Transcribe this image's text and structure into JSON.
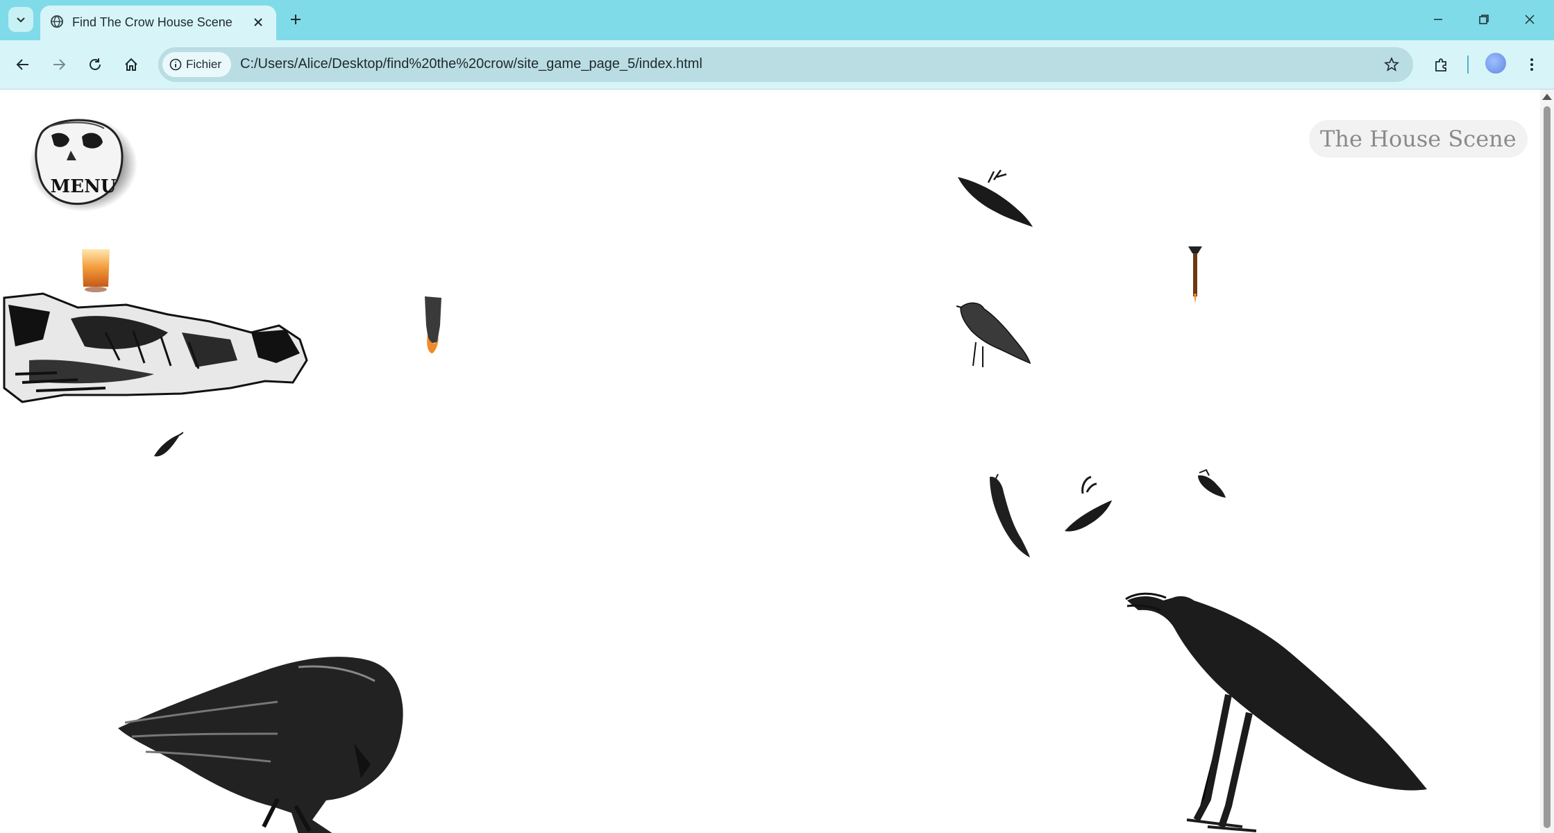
{
  "browser": {
    "tab_title": "Find The Crow House Scene",
    "security_chip_label": "Fichier",
    "url": "C:/Users/Alice/Desktop/find%20the%20crow/site_game_page_5/index.html"
  },
  "icons": {
    "tab_search": "chevron-down-icon",
    "favicon": "globe-icon",
    "tab_close": "close-icon",
    "new_tab": "plus-icon",
    "back": "back-arrow-icon",
    "forward": "forward-arrow-icon",
    "reload": "reload-icon",
    "home": "home-icon",
    "site_info": "info-icon",
    "bookmark": "star-icon",
    "extensions": "puzzle-icon",
    "menu": "kebab-menu-icon"
  },
  "page": {
    "menu_label": "MENU",
    "scene_title": "The House Scene"
  },
  "colors": {
    "tabstrip": "#7fdbe8",
    "toolbar": "#d7f5f9",
    "omnibox": "#b9dde3",
    "page_bg": "#ffffff",
    "crow": "#1a1a1a",
    "flame": "#f08a2a"
  }
}
